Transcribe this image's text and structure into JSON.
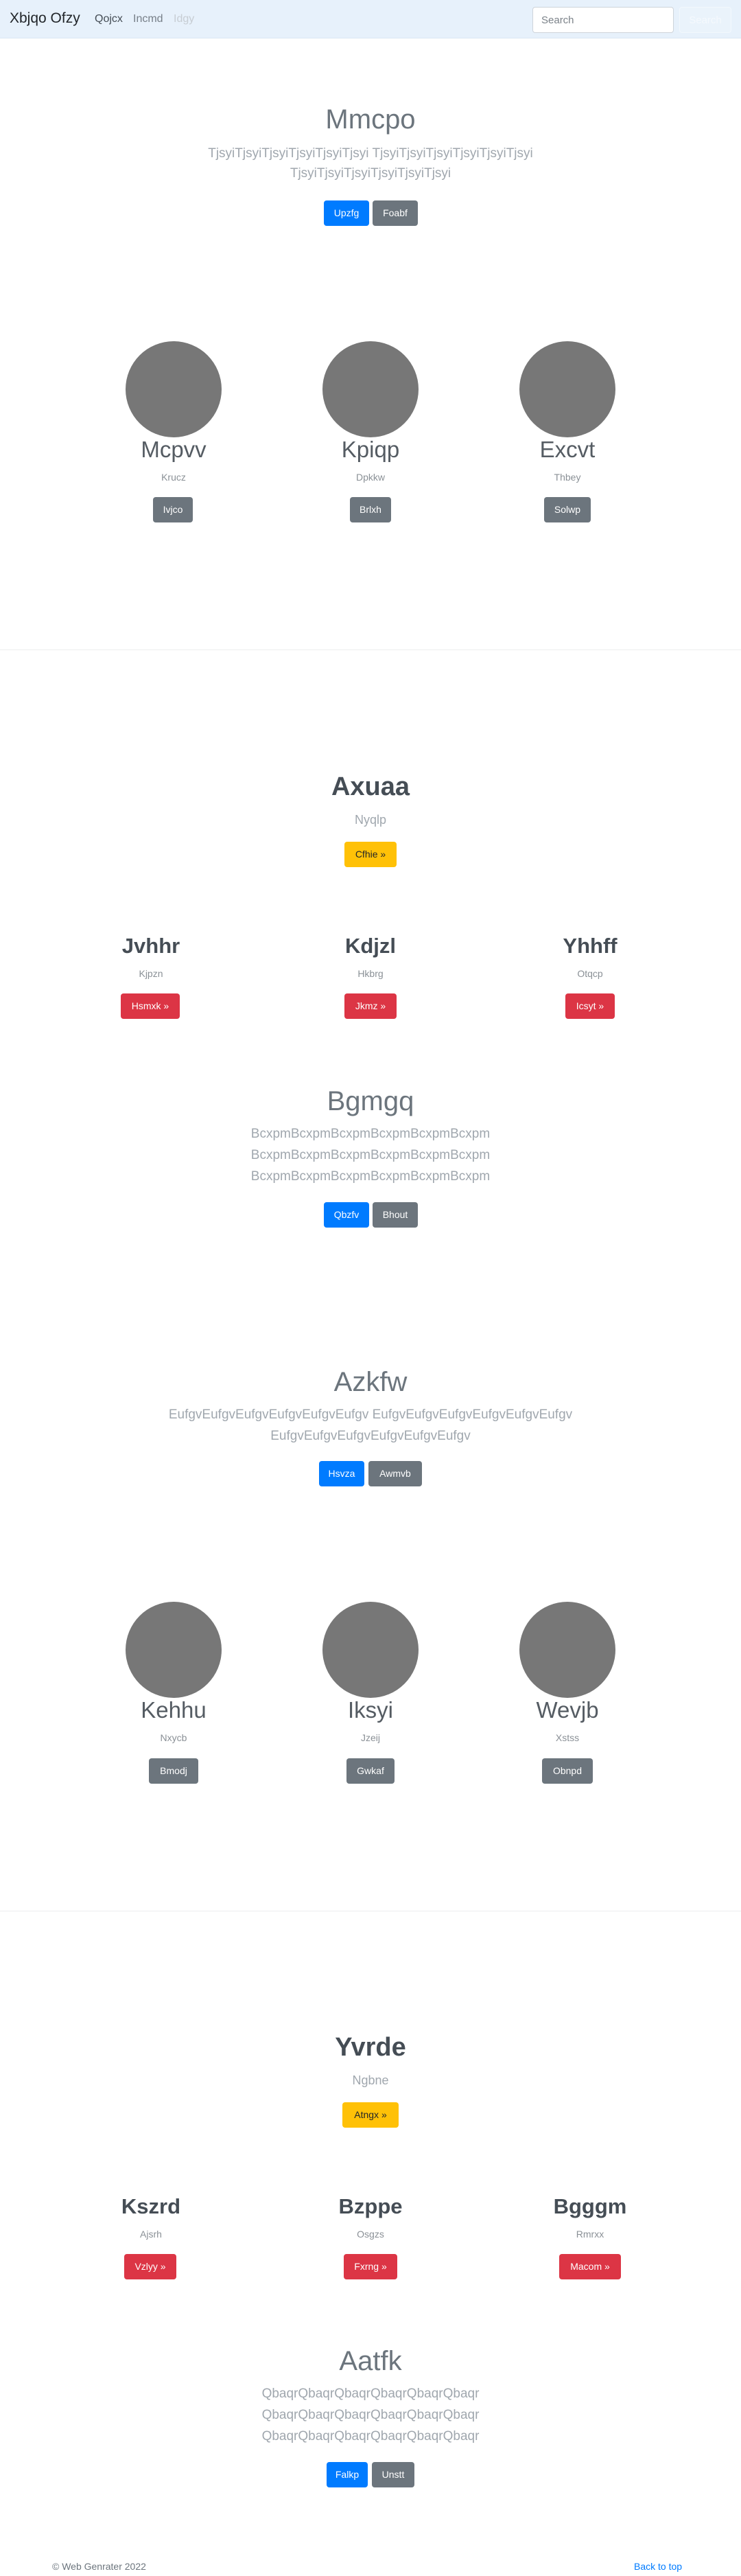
{
  "navbar": {
    "brand": "Xbjqo Ofzy",
    "links": [
      "Qojcx",
      "Incmd",
      "Idgy"
    ],
    "search_placeholder": "Search",
    "search_button": "Search"
  },
  "hero1": {
    "title": "Mmcpo",
    "lead_lines": [
      "TjsyiTjsyiTjsyiTjsyiTjsyiTjsyi TjsyiTjsyiTjsyiTjsyiTjsyiTjsyi",
      "TjsyiTjsyiTjsyiTjsyiTjsyiTjsyi"
    ],
    "primary": "Upzfg",
    "secondary": "Foabf"
  },
  "team1": [
    {
      "name": "Mcpvv",
      "role": "Krucz",
      "button": "Ivjco"
    },
    {
      "name": "Kpiqp",
      "role": "Dpkkw",
      "button": "Brlxh"
    },
    {
      "name": "Excvt",
      "role": "Thbey",
      "button": "Solwp"
    }
  ],
  "section2": {
    "title": "Axuaa",
    "subtitle": "Nyqlp",
    "button": "Cfhie »"
  },
  "features1": [
    {
      "title": "Jvhhr",
      "sub": "Kjpzn",
      "button": "Hsmxk »"
    },
    {
      "title": "Kdjzl",
      "sub": "Hkbrg",
      "button": "Jkmz »"
    },
    {
      "title": "Yhhff",
      "sub": "Otqcp",
      "button": "Icsyt »"
    }
  ],
  "hero2": {
    "title": "Bgmgq",
    "lead_lines": [
      "BcxpmBcxpmBcxpmBcxpmBcxpmBcxpm",
      "BcxpmBcxpmBcxpmBcxpmBcxpmBcxpm",
      "BcxpmBcxpmBcxpmBcxpmBcxpmBcxpm"
    ],
    "primary": "Qbzfv",
    "secondary": "Bhout"
  },
  "hero3": {
    "title": "Azkfw",
    "lead_lines": [
      "EufgvEufgvEufgvEufgvEufgvEufgv EufgvEufgvEufgvEufgvEufgvEufgv",
      "EufgvEufgvEufgvEufgvEufgvEufgv"
    ],
    "primary": "Hsvza",
    "secondary": "Awmvb"
  },
  "team2": [
    {
      "name": "Kehhu",
      "role": "Nxycb",
      "button": "Bmodj"
    },
    {
      "name": "Iksyi",
      "role": "Jzeij",
      "button": "Gwkaf"
    },
    {
      "name": "Wevjb",
      "role": "Xstss",
      "button": "Obnpd"
    }
  ],
  "section3": {
    "title": "Yvrde",
    "subtitle": "Ngbne",
    "button": "Atngx »"
  },
  "features2": [
    {
      "title": "Kszrd",
      "sub": "Ajsrh",
      "button": "Vzlyy »"
    },
    {
      "title": "Bzppe",
      "sub": "Osgzs",
      "button": "Fxrng »"
    },
    {
      "title": "Bgggm",
      "sub": "Rmrxx",
      "button": "Macom »"
    }
  ],
  "hero4": {
    "title": "Aatfk",
    "lead_lines": [
      "QbaqrQbaqrQbaqrQbaqrQbaqrQbaqr",
      "QbaqrQbaqrQbaqrQbaqrQbaqrQbaqr",
      "QbaqrQbaqrQbaqrQbaqrQbaqrQbaqr"
    ],
    "primary": "Falkp",
    "secondary": "Unstt"
  },
  "footer": {
    "copyright": "© Web Genrater 2022",
    "back_to_top": "Back to top"
  }
}
